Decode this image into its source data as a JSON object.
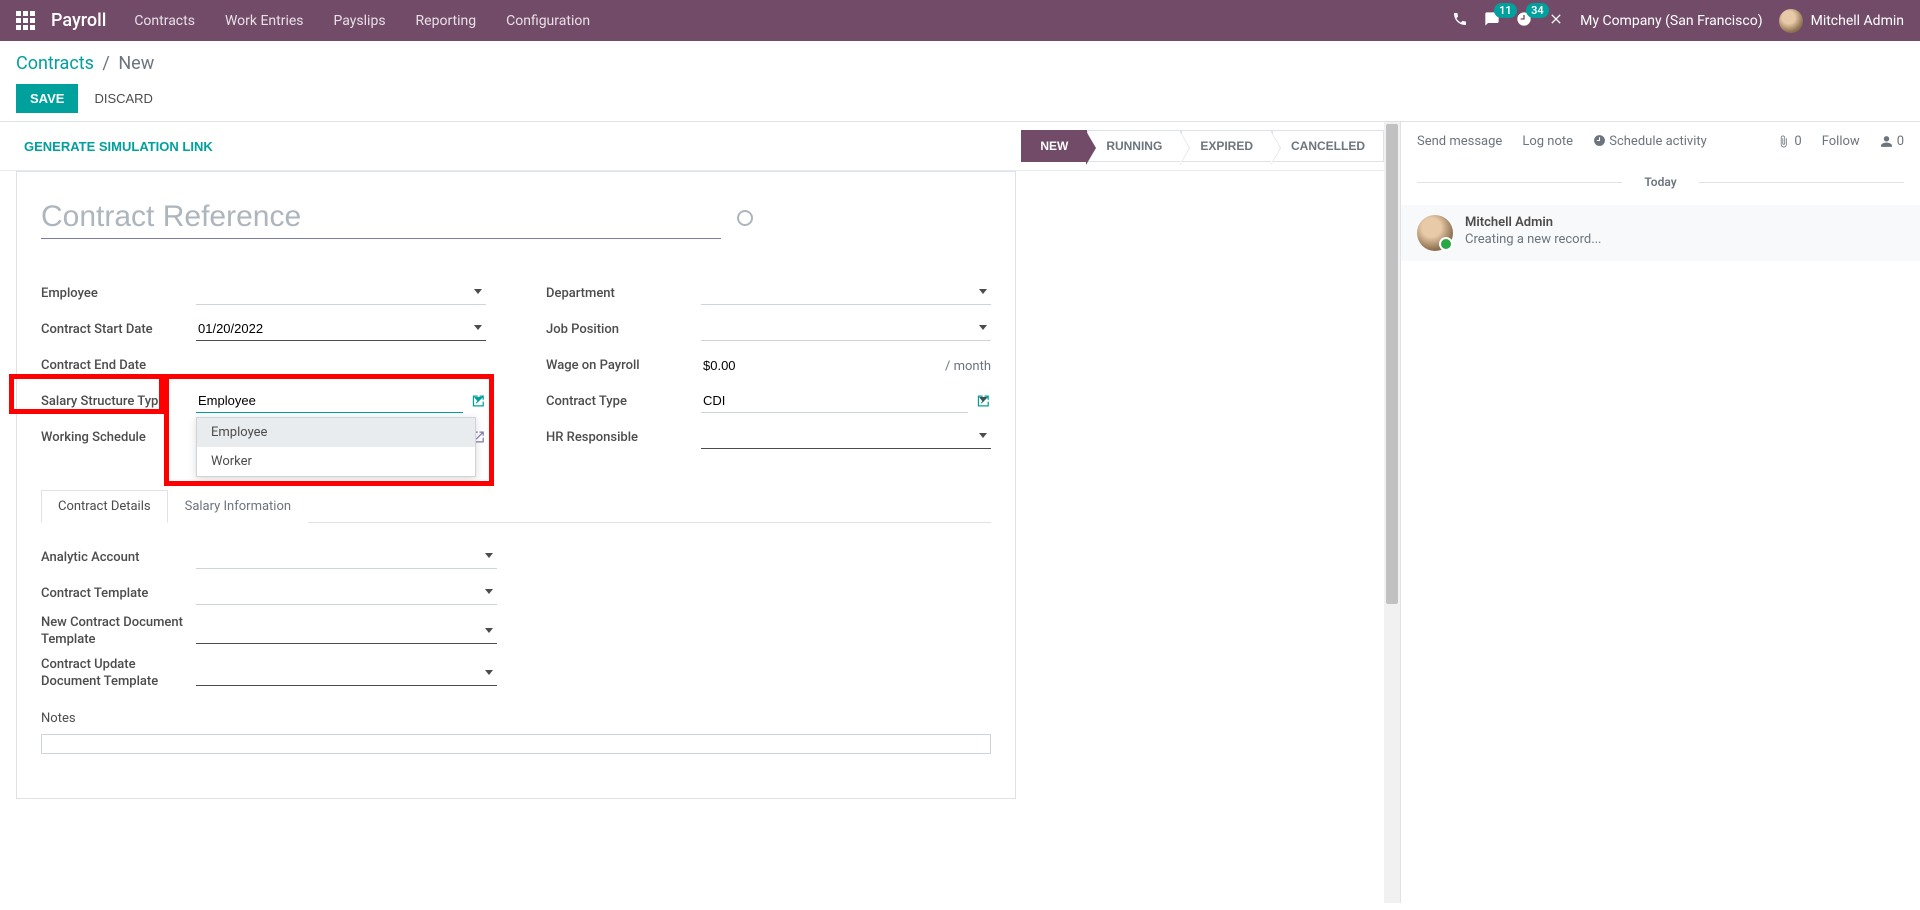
{
  "nav": {
    "app": "Payroll",
    "items": [
      "Contracts",
      "Work Entries",
      "Payslips",
      "Reporting",
      "Configuration"
    ],
    "msg_badge": "11",
    "activity_badge": "34",
    "company": "My Company (San Francisco)",
    "user": "Mitchell Admin"
  },
  "breadcrumb": {
    "root": "Contracts",
    "current": "New"
  },
  "buttons": {
    "save": "SAVE",
    "discard": "DISCARD",
    "genlink": "GENERATE SIMULATION LINK"
  },
  "statusbar": {
    "new": "NEW",
    "running": "RUNNING",
    "expired": "EXPIRED",
    "cancelled": "CANCELLED"
  },
  "form": {
    "title_placeholder": "Contract Reference",
    "labels": {
      "employee": "Employee",
      "start": "Contract Start Date",
      "end": "Contract End Date",
      "structure": "Salary Structure Type",
      "schedule": "Working Schedule",
      "department": "Department",
      "position": "Job Position",
      "wage": "Wage on Payroll",
      "ctype": "Contract Type",
      "hr": "HR Responsible"
    },
    "values": {
      "start": "01/20/2022",
      "structure": "Employee",
      "wage": "$0.00",
      "wage_unit": "/ month",
      "ctype": "CDI"
    },
    "dropdown": {
      "opt1": "Employee",
      "opt2": "Worker"
    }
  },
  "tabs": {
    "details": "Contract Details",
    "salary": "Salary Information"
  },
  "details": {
    "analytic": "Analytic Account",
    "template": "Contract Template",
    "newdoc": "New Contract Document Template",
    "updatedoc": "Contract Update Document Template",
    "notes": "Notes"
  },
  "chatter": {
    "send": "Send message",
    "log": "Log note",
    "schedule": "Schedule activity",
    "attach_count": "0",
    "follow": "Follow",
    "follower_count": "0",
    "today": "Today",
    "msg_author": "Mitchell Admin",
    "msg_body": "Creating a new record..."
  }
}
